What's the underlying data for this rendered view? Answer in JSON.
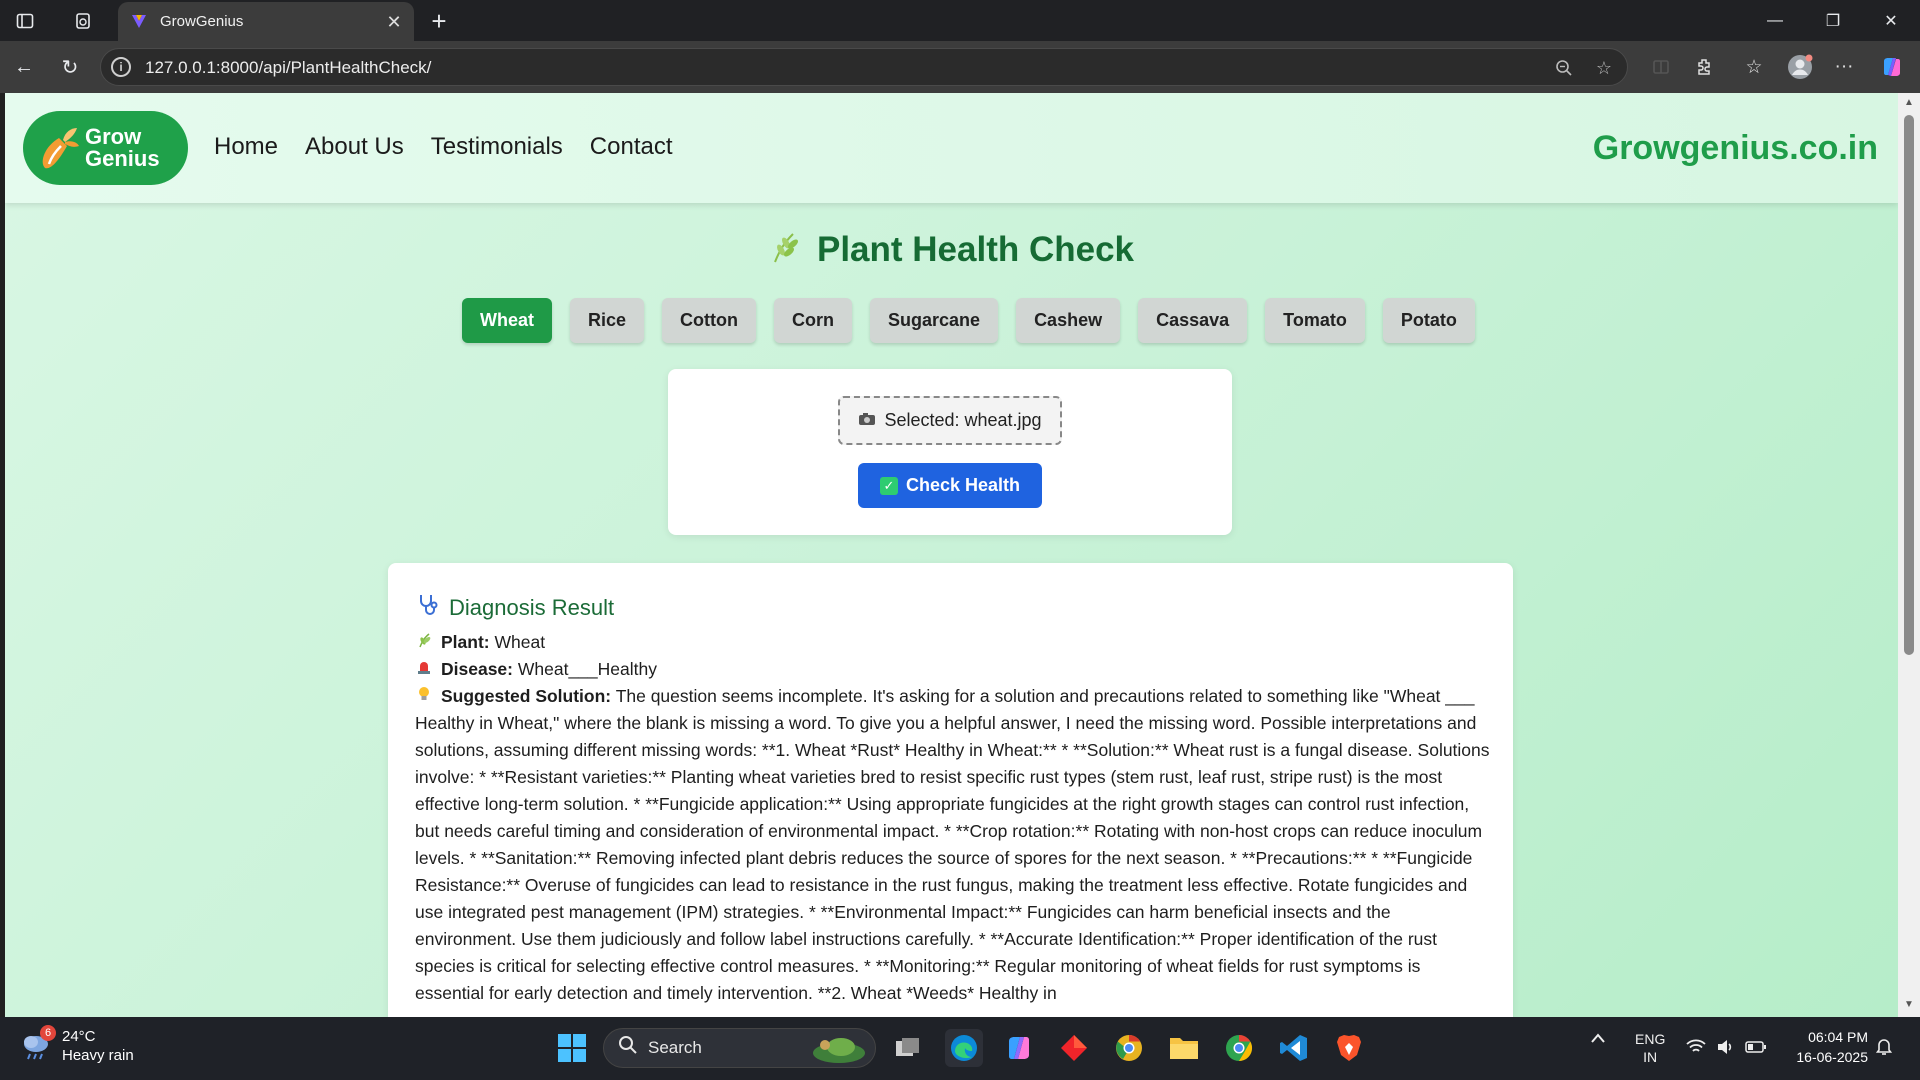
{
  "browser": {
    "tab_title": "GrowGenius",
    "url": "127.0.0.1:8000/api/PlantHealthCheck/"
  },
  "site": {
    "logo_line1": "Grow",
    "logo_line2": "Genius",
    "nav": [
      "Home",
      "About Us",
      "Testimonials",
      "Contact"
    ],
    "domain": "Growgenius.co.in",
    "accent_color": "#1f9d4a"
  },
  "page": {
    "title": "Plant Health Check",
    "crops": [
      "Wheat",
      "Rice",
      "Cotton",
      "Corn",
      "Sugarcane",
      "Cashew",
      "Cassava",
      "Tomato",
      "Potato"
    ],
    "active_crop": "Wheat",
    "upload": {
      "selected_text": "Selected: wheat.jpg",
      "check_button": "Check Health"
    },
    "result": {
      "title": "Diagnosis Result",
      "plant_label": "Plant:",
      "plant_value": "Wheat",
      "disease_label": "Disease:",
      "disease_value": "Wheat___Healthy",
      "solution_label": "Suggested Solution:",
      "solution_text": "The question seems incomplete. It's asking for a solution and precautions related to something like \"Wheat ___ Healthy in Wheat,\" where the blank is missing a word. To give you a helpful answer, I need the missing word. Possible interpretations and solutions, assuming different missing words: **1. Wheat *Rust* Healthy in Wheat:** * **Solution:** Wheat rust is a fungal disease. Solutions involve: * **Resistant varieties:** Planting wheat varieties bred to resist specific rust types (stem rust, leaf rust, stripe rust) is the most effective long-term solution. * **Fungicide application:** Using appropriate fungicides at the right growth stages can control rust infection, but needs careful timing and consideration of environmental impact. * **Crop rotation:** Rotating with non-host crops can reduce inoculum levels. * **Sanitation:** Removing infected plant debris reduces the source of spores for the next season. * **Precautions:** * **Fungicide Resistance:** Overuse of fungicides can lead to resistance in the rust fungus, making the treatment less effective. Rotate fungicides and use integrated pest management (IPM) strategies. * **Environmental Impact:** Fungicides can harm beneficial insects and the environment. Use them judiciously and follow label instructions carefully. * **Accurate Identification:** Proper identification of the rust species is critical for selecting effective control measures. * **Monitoring:** Regular monitoring of wheat fields for rust symptoms is essential for early detection and timely intervention. **2. Wheat *Weeds* Healthy in"
    }
  },
  "taskbar": {
    "weather_temp": "24°C",
    "weather_desc": "Heavy rain",
    "weather_badge": "6",
    "search_placeholder": "Search",
    "lang1": "ENG",
    "lang2": "IN",
    "time": "06:04 PM",
    "date": "16-06-2025"
  }
}
